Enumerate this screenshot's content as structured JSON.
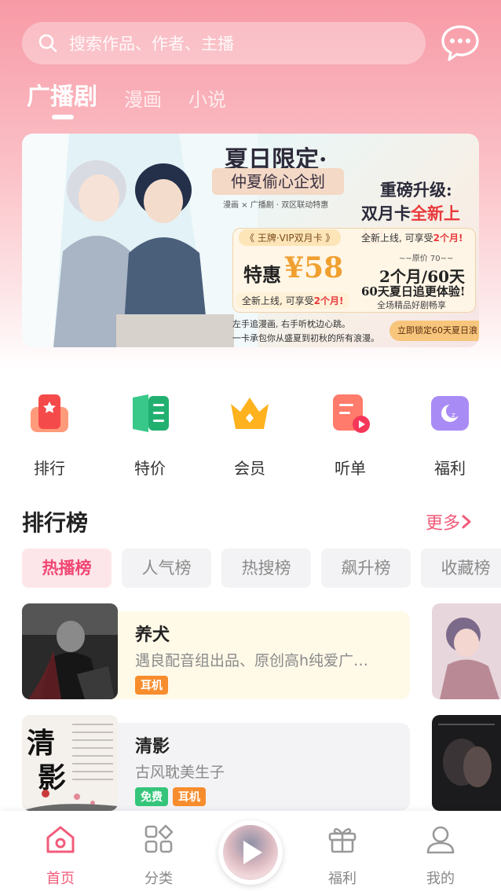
{
  "colors": {
    "accent": "#f25b7a",
    "header_gradient_top": "#f79aa6",
    "tag_orange": "#f78d2d",
    "tag_green": "#35c57a"
  },
  "header": {
    "search_placeholder": "搜索作品、作者、主播",
    "chat_icon": "chat-bubble-icon",
    "tabs": [
      {
        "label": "广播剧",
        "active": true
      },
      {
        "label": "漫画"
      },
      {
        "label": "小说"
      }
    ]
  },
  "banner": {
    "title": "夏日限定·",
    "ribbon": "仲夏偷心企划",
    "subtitle": "漫画 × 广播剧 · 双区联动特惠",
    "upgrade_line1": "重磅升级:",
    "upgrade_line2_a": "双月卡",
    "upgrade_line2_b": "全新上线!",
    "vip_label": "《 王牌·VIP双月卡 》",
    "new_line_a": "全新上线, 可享受",
    "new_line_b": "2个月!",
    "price_label": "特惠",
    "price": "¥58",
    "orig_price": "~~原价 70~~",
    "months": "2个月/60天",
    "days_line": "60天夏日追更体验!",
    "all_line": "全场精品好剧畅享",
    "foot1": "左手追漫画, 右手听枕边心跳。",
    "foot2": "一卡承包你从盛夏到初秋的所有浪漫。",
    "cta": "立即锁定60天夏日浪"
  },
  "quick_entries": [
    {
      "label": "排行",
      "icon": "ranking-icon"
    },
    {
      "label": "特价",
      "icon": "book-discount-icon"
    },
    {
      "label": "会员",
      "icon": "crown-icon"
    },
    {
      "label": "听单",
      "icon": "playlist-icon"
    },
    {
      "label": "福利",
      "icon": "moon-gift-icon"
    }
  ],
  "ranking": {
    "title": "排行榜",
    "more": "更多",
    "chips": [
      {
        "label": "热播榜",
        "active": true
      },
      {
        "label": "人气榜"
      },
      {
        "label": "热搜榜"
      },
      {
        "label": "飙升榜"
      },
      {
        "label": "收藏榜"
      }
    ],
    "items": [
      {
        "title": "养犬",
        "desc": "遇良配音组出品、原创高h纯爱广…",
        "tags": [
          {
            "label": "耳机",
            "color": "orange"
          }
        ]
      },
      {
        "title": "清影",
        "desc": "古风耽美生子",
        "tags": [
          {
            "label": "免费",
            "color": "green"
          },
          {
            "label": "耳机",
            "color": "orange"
          }
        ]
      }
    ],
    "cover_text": {
      "cover2_big_1": "清",
      "cover2_big_2": "影"
    }
  },
  "bottom_nav": [
    {
      "label": "首页",
      "icon": "home-icon",
      "active": true
    },
    {
      "label": "分类",
      "icon": "category-icon"
    },
    {
      "label": "福利",
      "icon": "gift-icon"
    },
    {
      "label": "我的",
      "icon": "user-icon"
    }
  ]
}
